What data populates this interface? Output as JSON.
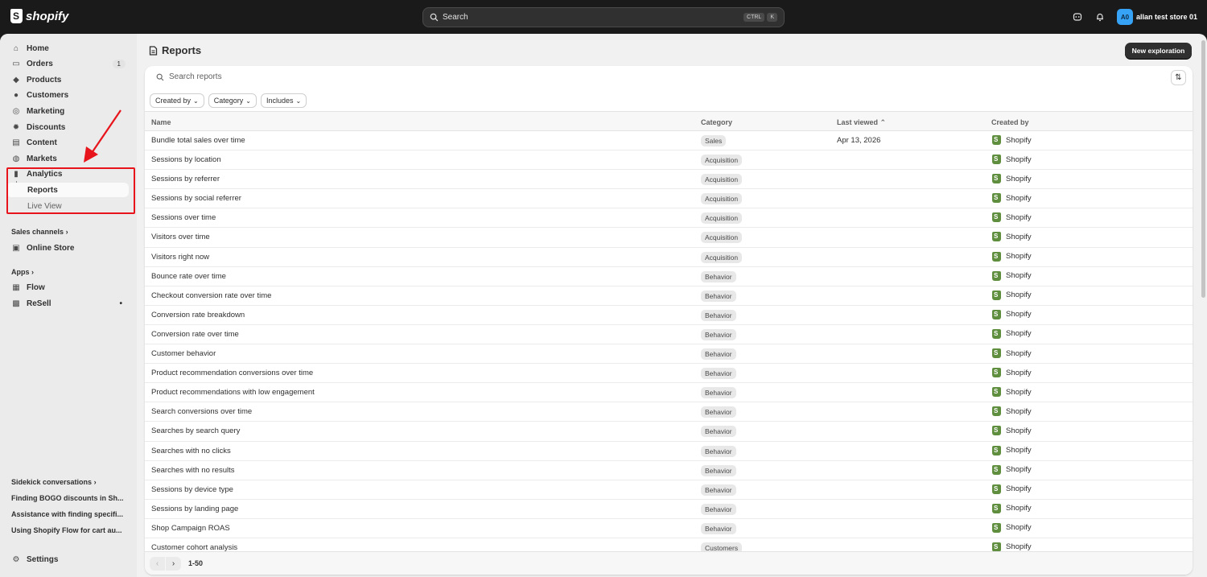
{
  "topbar": {
    "logo_text": "shopify",
    "search_placeholder": "Search",
    "kbd_ctrl": "CTRL",
    "kbd_k": "K",
    "avatar_initials": "A0",
    "store_name": "allan test store 01"
  },
  "sidebar": {
    "home": "Home",
    "orders": "Orders",
    "orders_count": "1",
    "products": "Products",
    "customers": "Customers",
    "marketing": "Marketing",
    "discounts": "Discounts",
    "content": "Content",
    "markets": "Markets",
    "analytics": "Analytics",
    "reports": "Reports",
    "live_view": "Live View",
    "sales_channels": "Sales channels",
    "online_store": "Online Store",
    "apps": "Apps",
    "flow": "Flow",
    "resell": "ReSell",
    "sidekick": "Sidekick conversations",
    "conv1": "Finding BOGO discounts in Sh...",
    "conv2": "Assistance with finding specifi...",
    "conv3": "Using Shopify Flow for cart au...",
    "settings": "Settings"
  },
  "main": {
    "title": "Reports",
    "new_button": "New exploration",
    "search_placeholder": "Search reports",
    "filters": [
      "Created by",
      "Category",
      "Includes"
    ],
    "columns": {
      "name": "Name",
      "category": "Category",
      "last_viewed": "Last viewed",
      "created_by": "Created by"
    },
    "rows": [
      {
        "name": "Bundle total sales over time",
        "category": "Sales",
        "last": "Apr 13, 2026",
        "by": "Shopify"
      },
      {
        "name": "Sessions by location",
        "category": "Acquisition",
        "last": "",
        "by": "Shopify"
      },
      {
        "name": "Sessions by referrer",
        "category": "Acquisition",
        "last": "",
        "by": "Shopify"
      },
      {
        "name": "Sessions by social referrer",
        "category": "Acquisition",
        "last": "",
        "by": "Shopify"
      },
      {
        "name": "Sessions over time",
        "category": "Acquisition",
        "last": "",
        "by": "Shopify"
      },
      {
        "name": "Visitors over time",
        "category": "Acquisition",
        "last": "",
        "by": "Shopify"
      },
      {
        "name": "Visitors right now",
        "category": "Acquisition",
        "last": "",
        "by": "Shopify"
      },
      {
        "name": "Bounce rate over time",
        "category": "Behavior",
        "last": "",
        "by": "Shopify"
      },
      {
        "name": "Checkout conversion rate over time",
        "category": "Behavior",
        "last": "",
        "by": "Shopify"
      },
      {
        "name": "Conversion rate breakdown",
        "category": "Behavior",
        "last": "",
        "by": "Shopify"
      },
      {
        "name": "Conversion rate over time",
        "category": "Behavior",
        "last": "",
        "by": "Shopify"
      },
      {
        "name": "Customer behavior",
        "category": "Behavior",
        "last": "",
        "by": "Shopify"
      },
      {
        "name": "Product recommendation conversions over time",
        "category": "Behavior",
        "last": "",
        "by": "Shopify"
      },
      {
        "name": "Product recommendations with low engagement",
        "category": "Behavior",
        "last": "",
        "by": "Shopify"
      },
      {
        "name": "Search conversions over time",
        "category": "Behavior",
        "last": "",
        "by": "Shopify"
      },
      {
        "name": "Searches by search query",
        "category": "Behavior",
        "last": "",
        "by": "Shopify"
      },
      {
        "name": "Searches with no clicks",
        "category": "Behavior",
        "last": "",
        "by": "Shopify"
      },
      {
        "name": "Searches with no results",
        "category": "Behavior",
        "last": "",
        "by": "Shopify"
      },
      {
        "name": "Sessions by device type",
        "category": "Behavior",
        "last": "",
        "by": "Shopify"
      },
      {
        "name": "Sessions by landing page",
        "category": "Behavior",
        "last": "",
        "by": "Shopify"
      },
      {
        "name": "Shop Campaign ROAS",
        "category": "Behavior",
        "last": "",
        "by": "Shopify"
      },
      {
        "name": "Customer cohort analysis",
        "category": "Customers",
        "last": "",
        "by": "Shopify"
      }
    ],
    "pagination": "1-50"
  },
  "colors": {
    "annotation": "#e8141b",
    "shopify_green": "#5e8e3e",
    "primary_button": "#303030"
  }
}
